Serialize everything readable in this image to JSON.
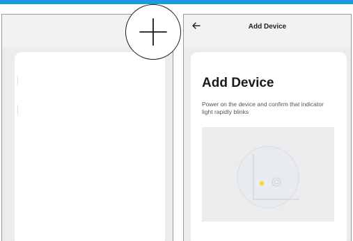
{
  "header": {
    "title": "Add Device",
    "back_icon": "back-arrow-icon"
  },
  "card": {
    "title": "Add Device",
    "description": "Power on the device and confirm that indicator light rapidly blinks"
  },
  "illustration": {
    "indicator_color": "#f5d81c"
  },
  "colors": {
    "accent": "#1e9bdd"
  },
  "overlay_icon": "plus-icon"
}
